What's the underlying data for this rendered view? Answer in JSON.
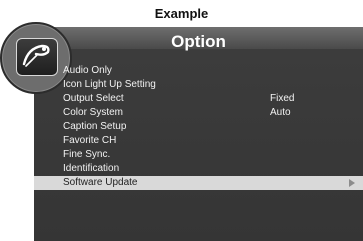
{
  "caption": "Example",
  "title": "Option",
  "menu": {
    "items": [
      {
        "label": "Audio Only",
        "value": ""
      },
      {
        "label": "Icon Light Up Setting",
        "value": ""
      },
      {
        "label": "Output Select",
        "value": "Fixed"
      },
      {
        "label": "Color System",
        "value": "Auto"
      },
      {
        "label": "Caption Setup",
        "value": ""
      },
      {
        "label": "Favorite CH",
        "value": ""
      },
      {
        "label": "Fine Sync.",
        "value": ""
      },
      {
        "label": "Identification",
        "value": ""
      },
      {
        "label": "Software Update",
        "value": "",
        "selected": true,
        "icon": "chevron-right-icon"
      }
    ]
  },
  "logo_icon": "speaker-icon",
  "colors": {
    "panel": "#3c3c3c",
    "highlight": "#d9d9d9",
    "text": "#f2f2f2"
  }
}
